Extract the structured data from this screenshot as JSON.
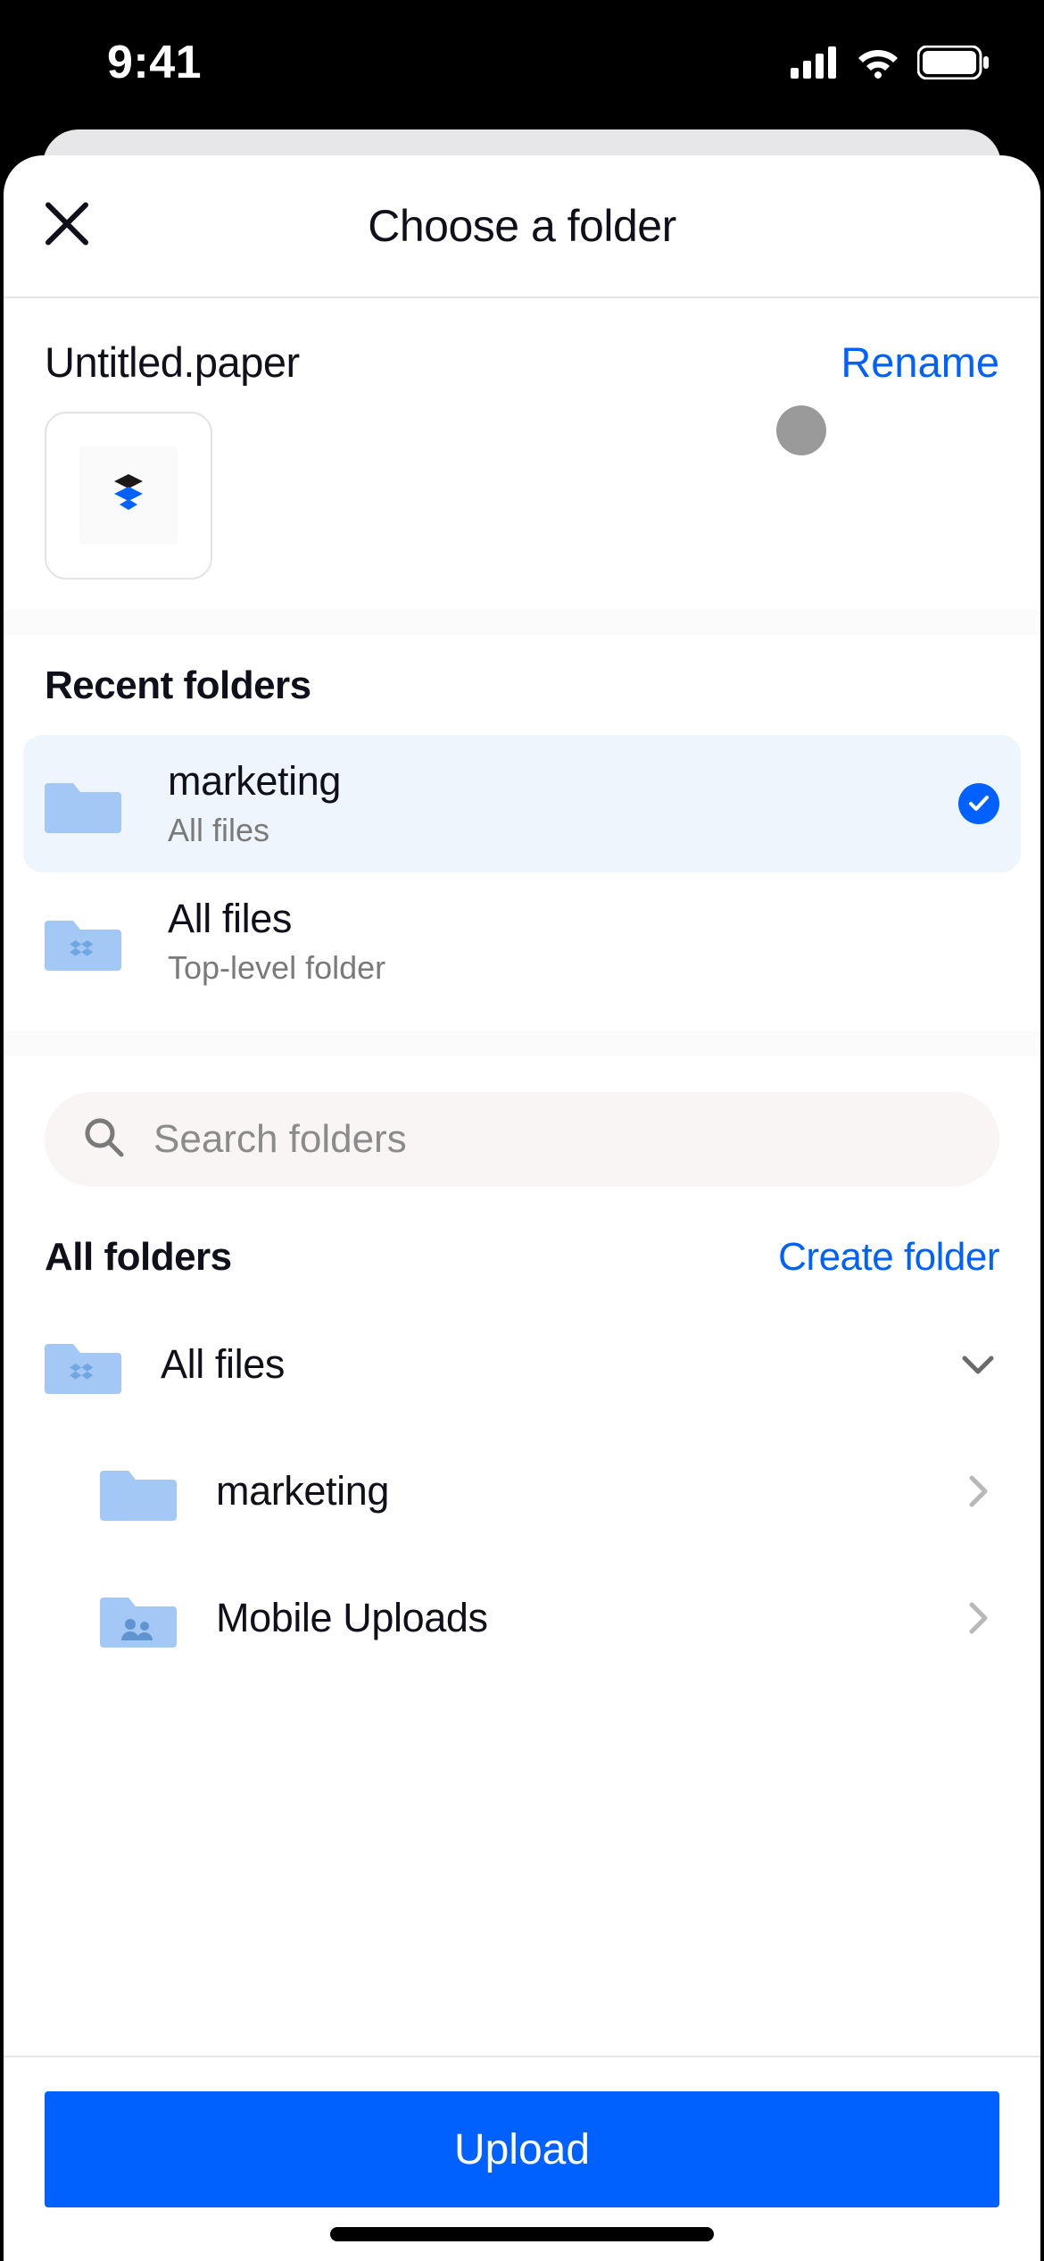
{
  "statusbar": {
    "time": "9:41"
  },
  "header": {
    "title": "Choose a folder"
  },
  "file": {
    "name": "Untitled.paper",
    "rename_label": "Rename"
  },
  "recent": {
    "heading": "Recent folders",
    "items": [
      {
        "name": "marketing",
        "sub": "All files",
        "selected": true,
        "icon": "folder"
      },
      {
        "name": "All files",
        "sub": "Top-level folder",
        "selected": false,
        "icon": "dropbox-folder"
      }
    ]
  },
  "search": {
    "placeholder": "Search folders"
  },
  "all_folders": {
    "heading": "All folders",
    "create_label": "Create folder",
    "tree": [
      {
        "name": "All files",
        "icon": "dropbox-folder",
        "depth": 0,
        "expanded": true
      },
      {
        "name": "marketing",
        "icon": "folder",
        "depth": 1,
        "expanded": false
      },
      {
        "name": "Mobile Uploads",
        "icon": "shared-folder",
        "depth": 1,
        "expanded": false
      }
    ]
  },
  "upload": {
    "label": "Upload"
  }
}
